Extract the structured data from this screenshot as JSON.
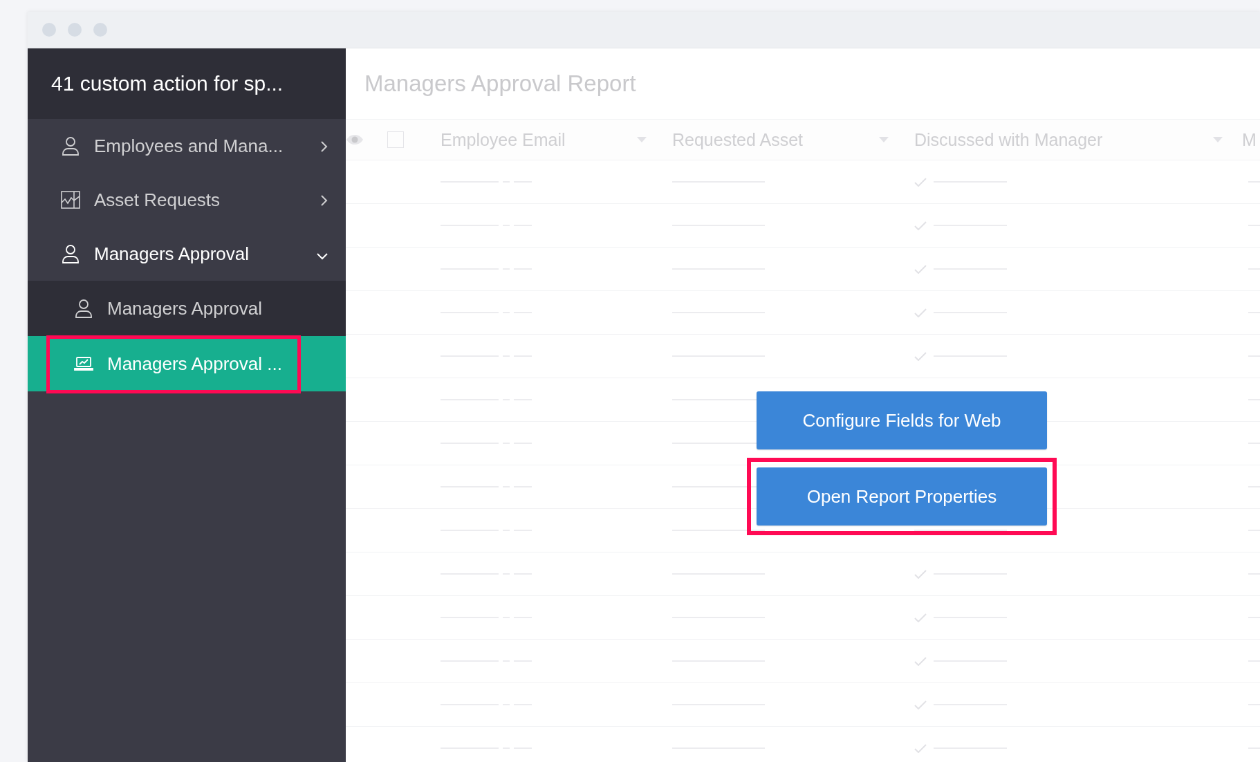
{
  "app": {
    "title": "41 custom action for sp..."
  },
  "nav": [
    {
      "label": "Employees and Mana...",
      "kind": "person",
      "expanded": false,
      "selected": false,
      "highlighted": false
    },
    {
      "label": "Asset Requests",
      "kind": "chart",
      "expanded": false,
      "selected": false,
      "highlighted": false
    },
    {
      "label": "Managers Approval",
      "kind": "person",
      "expanded": true,
      "selected": false,
      "highlighted": false,
      "children": [
        {
          "label": "Managers Approval",
          "kind": "person",
          "selected": false,
          "highlighted": false
        },
        {
          "label": "Managers Approval ...",
          "kind": "laptop",
          "selected": true,
          "highlighted": true
        }
      ]
    }
  ],
  "report": {
    "title": "Managers Approval Report",
    "select_all": {
      "checked": false
    },
    "columns": [
      {
        "label": "Employee Email"
      },
      {
        "label": "Requested Asset"
      },
      {
        "label": "Discussed with Manager"
      },
      {
        "label": "M"
      }
    ]
  },
  "actions": [
    {
      "label": "Configure Fields for Web",
      "highlighted": false
    },
    {
      "label": "Open Report Properties",
      "highlighted": true
    }
  ]
}
